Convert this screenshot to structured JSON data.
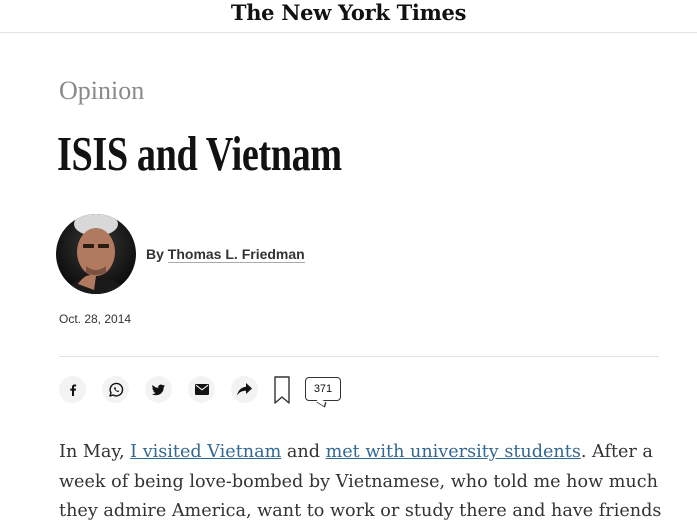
{
  "masthead": {
    "logo_text": "The New York Times"
  },
  "article": {
    "kicker": "Opinion",
    "headline": "ISIS and Vietnam",
    "byline_prefix": "By ",
    "author": "Thomas L. Friedman",
    "date": "Oct. 28, 2014",
    "comment_count": "371",
    "body": {
      "t1": "In May, ",
      "link1": "I visited Vietnam",
      "t2": " and ",
      "link2": "met with university students",
      "t3": ". After a week of being love-bombed by Vietnamese, who told me how much they admire America, want to work or study there and have friends"
    }
  },
  "share_icons": [
    "facebook-icon",
    "whatsapp-icon",
    "twitter-icon",
    "email-icon",
    "share-icon",
    "bookmark-icon",
    "comment-icon"
  ],
  "colors": {
    "link": "#326891",
    "kicker": "#8a8a8a",
    "text": "#121212"
  }
}
